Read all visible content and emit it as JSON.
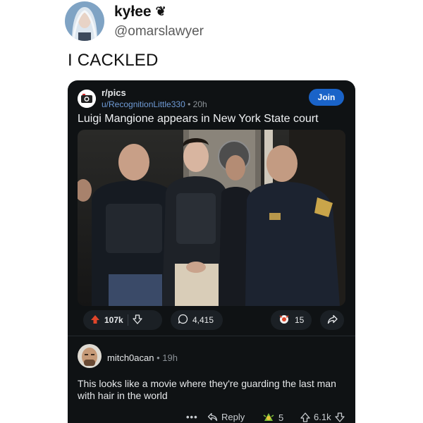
{
  "tweet": {
    "display_name": "kyłee",
    "name_emoji": "❦",
    "handle": "@omarslawyer",
    "text": "I CACKLED"
  },
  "post": {
    "subreddit": "r/pics",
    "meta_user": "u/RecognitionLittle330",
    "meta_time": "20h",
    "join_label": "Join",
    "title": "Luigi Mangione appears in New York State court",
    "upvotes": "107k",
    "comments": "4,415",
    "awards": "15"
  },
  "comment": {
    "username": "mitch0acan",
    "time": "19h",
    "body": "This looks like a movie where they're guarding the last man with hair in the world",
    "more": "•••",
    "reply_label": "Reply",
    "award_count": "5",
    "votes": "6.1k"
  },
  "colors": {
    "card_bg": "#0f1214",
    "upvote": "#e0452a",
    "join": "#1a63c8",
    "link": "#6f9bd6"
  }
}
